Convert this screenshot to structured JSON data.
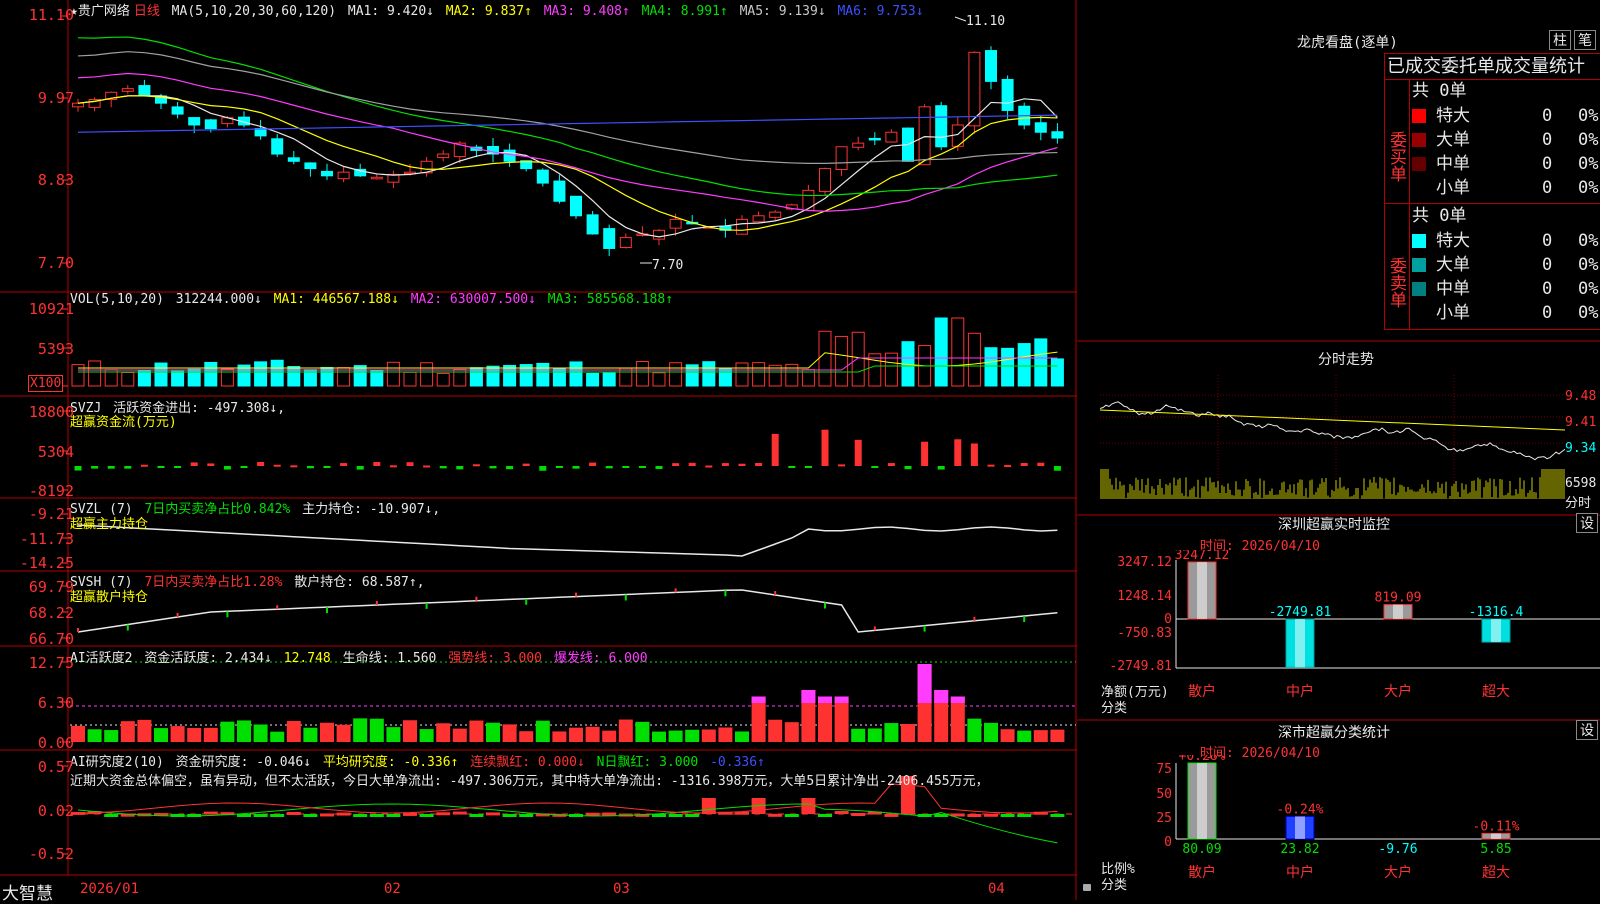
{
  "colors": {
    "up": "#ff3232",
    "down": "#00ffff",
    "ma1": "#e8e8e8",
    "ma2": "#ffff00",
    "ma3": "#ff3cff",
    "ma4": "#00e000",
    "ma5": "#a0a0a0",
    "ma6": "#3c50ff",
    "frame": "#b40000"
  },
  "main": {
    "stock_name": "★贵广网络",
    "period": "日线",
    "ma_title": "MA(5,10,20,30,60,120)",
    "ma": [
      {
        "label": "MA1: 9.420↓"
      },
      {
        "label": "MA2: 9.837↑"
      },
      {
        "label": "MA3: 9.408↑"
      },
      {
        "label": "MA4: 8.991↑"
      },
      {
        "label": "MA5: 9.139↓"
      },
      {
        "label": "MA6: 9.753↓"
      }
    ],
    "yticks": [
      "11.10",
      "9.97",
      "8.83",
      "7.70"
    ],
    "high_label": "11.10",
    "low_label": "7.70"
  },
  "vol": {
    "title": "VOL(5,10,20)",
    "value": "312244.000↓",
    "ma1": "MA1: 446567.188↓",
    "ma2": "MA2: 630007.500↓",
    "ma3": "MA3: 585568.188↑",
    "yticks": [
      "10921",
      "5393",
      "X100"
    ]
  },
  "svzj": {
    "title": "SVZJ",
    "sub": "活跃资金进出: -497.308↓,",
    "caption": "超赢资金流(万元)",
    "yticks": [
      "18800",
      "5304",
      "-8192"
    ]
  },
  "svzl": {
    "title": "SVZL (7)",
    "a": "7日内买卖净占比0.842%",
    "b": "主力持仓: -10.907↓,",
    "caption": "超赢主力持仓",
    "yticks": [
      "-9.21",
      "-11.73",
      "-14.25"
    ]
  },
  "svsh": {
    "title": "SVSH (7)",
    "a": "7日内买卖净占比1.28%",
    "b": "散户持仓: 68.587↑,",
    "caption": "超赢散户持仓",
    "yticks": [
      "69.79",
      "68.22",
      "66.70"
    ]
  },
  "ai1": {
    "title": "AI活跃度2",
    "a": "资金活跃度: 2.434↓",
    "b": "12.748",
    "c": "生命线: 1.560",
    "d": "强势线: 3.000",
    "e": "爆发线: 6.000",
    "yticks": [
      "12.75",
      "6.30",
      "0.00"
    ]
  },
  "ai2": {
    "title": "AI研究度2(10)",
    "a": "资金研究度: -0.046↓",
    "b": "平均研究度: -0.336↑",
    "c": "连续飘红: 0.000↓",
    "d": "N日飘红: 3.000",
    "e": "-0.336↑",
    "comment": "近期大资金总体偏空，虽有异动，但不太活跃，今日大单净流出: -497.306万元，其中特大单净流出: -1316.398万元，大单5日累计净出-2406.455万元，",
    "yticks": [
      "0.57",
      "0.02",
      "-0.52"
    ]
  },
  "xaxis": {
    "logo": "大智慧",
    "labels": [
      "2026/01",
      "02",
      "03",
      "04"
    ]
  },
  "longhu": {
    "title": "龙虎看盘(逐单)",
    "btn1": "柱",
    "btn2": "笔",
    "subtitle": "已成交委托单成交量统计",
    "buy": {
      "label": "委买单",
      "total": "共 0单",
      "rows": [
        {
          "name": "特大",
          "v": "0",
          "p": "0%"
        },
        {
          "name": "大单",
          "v": "0",
          "p": "0%"
        },
        {
          "name": "中单",
          "v": "0",
          "p": "0%"
        },
        {
          "name": "小单",
          "v": "0",
          "p": "0%"
        }
      ]
    },
    "sell": {
      "label": "委卖单",
      "total": "共 0单",
      "rows": [
        {
          "name": "特大",
          "v": "0",
          "p": "0%"
        },
        {
          "name": "大单",
          "v": "0",
          "p": "0%"
        },
        {
          "name": "中单",
          "v": "0",
          "p": "0%"
        },
        {
          "name": "小单",
          "v": "0",
          "p": "0%"
        }
      ]
    }
  },
  "fenshi": {
    "title": "分时走势",
    "yticks": [
      "9.48",
      "9.41",
      "9.34"
    ],
    "vol": "6598",
    "vol_label": "分时"
  },
  "monitor": {
    "title": "深圳超赢实时监控",
    "btn": "设",
    "time": "时间: 2026/04/10",
    "ylabel": "净额(万元)",
    "xlabel": "分类",
    "yticks": [
      "3247.12",
      "1248.14",
      "0",
      "-750.83",
      "-2749.81"
    ],
    "categories": [
      "散户",
      "中户",
      "大户",
      "超大"
    ],
    "values": [
      3247.12,
      -2749.81,
      819.09,
      -1316.4
    ],
    "value_labels": [
      "3247.12",
      "-2749.81",
      "819.09",
      "-1316.4"
    ]
  },
  "classify": {
    "title": "深市超赢分类统计",
    "btn": "设",
    "time": "时间: 2026/04/10",
    "ylabel": "比例%",
    "xlabel": "分类",
    "yticks": [
      "75",
      "50",
      "25",
      "0"
    ],
    "categories": [
      "散户",
      "中户",
      "大户",
      "超大"
    ],
    "pct": [
      "+0.28%",
      "-0.24%",
      "",
      "-0.11%"
    ],
    "values": [
      80.09,
      23.82,
      -9.76,
      5.85
    ],
    "value_labels": [
      "80.09",
      "23.82",
      "-9.76",
      "5.85"
    ]
  }
}
